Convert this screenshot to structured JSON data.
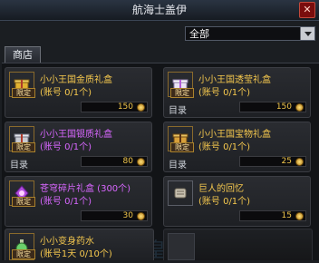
{
  "window": {
    "title": "航海士盖伊"
  },
  "filter": {
    "selected": "全部"
  },
  "tabs": [
    {
      "label": "商店"
    }
  ],
  "cards": [
    {
      "name": "小小王国金质礼盒",
      "sub": "(账号 0/1个)",
      "badge": "限定",
      "directory": "",
      "price": "150",
      "name_color": "#f5c84e"
    },
    {
      "name": "小小王国透莹礼盒",
      "sub": "(账号 0/1个)",
      "badge": "限定",
      "directory": "目录",
      "price": "150",
      "name_color": "#f5c84e"
    },
    {
      "name": "小小王国银质礼盒",
      "sub": "(账号 0/1个)",
      "badge": "限定",
      "directory": "目录",
      "price": "80",
      "name_color": "#d867ff"
    },
    {
      "name": "小小王国宝物礼盒",
      "sub": "(账号 0/1个)",
      "badge": "限定",
      "directory": "目录",
      "price": "25",
      "name_color": "#f5c84e"
    },
    {
      "name": "苍穹碎片礼盒 (300个)",
      "sub": "(账号 0/1个)",
      "badge": "限定",
      "directory": "",
      "price": "30",
      "name_color": "#d867ff"
    },
    {
      "name": "巨人的回忆",
      "sub": "(账号 0/1个)",
      "badge": "",
      "directory": "",
      "price": "15",
      "name_color": "#f5c84e"
    },
    {
      "name": "小小变身药水",
      "sub": "(账号1天 0/10个)",
      "badge": "限定",
      "directory": "",
      "price": "",
      "name_color": "#f5c84e"
    }
  ]
}
